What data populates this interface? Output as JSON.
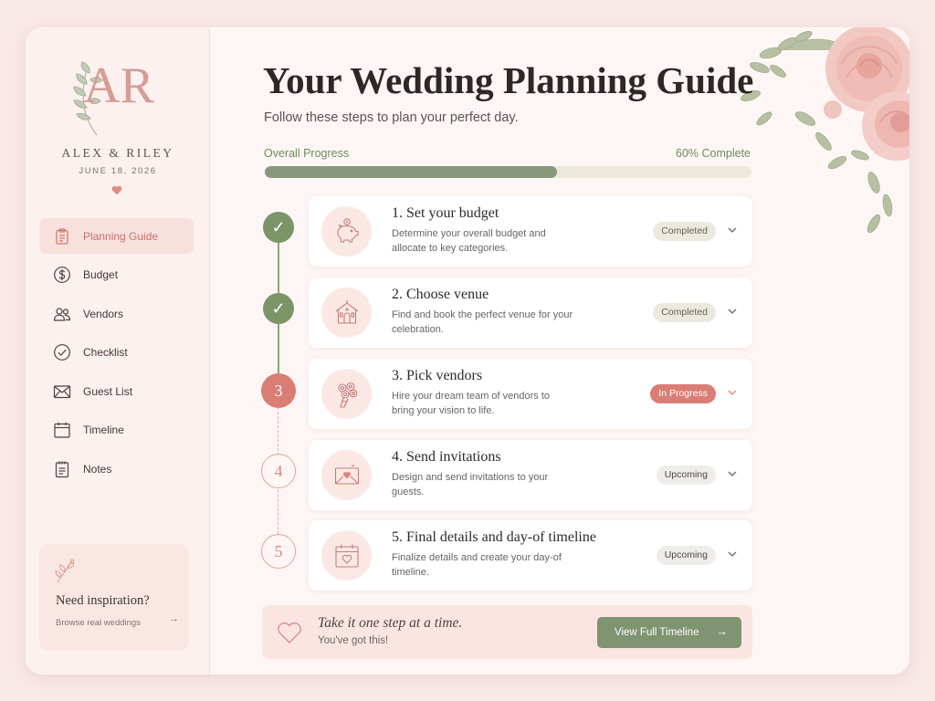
{
  "brand": {
    "monogram": "AR",
    "couple_name": "ALEX & RILEY",
    "wedding_date": "JUNE 18, 2026",
    "accent_color": "#d97d75",
    "sage_color": "#7f9470"
  },
  "sidebar": {
    "items": [
      {
        "label": "Planning Guide",
        "icon": "clipboard-icon",
        "active": true
      },
      {
        "label": "Budget",
        "icon": "dollar-icon",
        "active": false
      },
      {
        "label": "Vendors",
        "icon": "people-icon",
        "active": false
      },
      {
        "label": "Checklist",
        "icon": "check-circle-icon",
        "active": false
      },
      {
        "label": "Guest List",
        "icon": "envelope-icon",
        "active": false
      },
      {
        "label": "Timeline",
        "icon": "calendar-icon",
        "active": false
      },
      {
        "label": "Notes",
        "icon": "notepad-icon",
        "active": false
      }
    ],
    "inspiration": {
      "title": "Need inspiration?",
      "link_label": "Browse real weddings",
      "arrow": "→"
    }
  },
  "header": {
    "title": "Your Wedding Planning Guide",
    "subtitle": "Follow these steps to plan your perfect day."
  },
  "progress": {
    "label": "Overall Progress",
    "percent_label": "60% Complete",
    "value": 0.6
  },
  "steps": [
    {
      "marker": "✓",
      "title": "1. Set your budget",
      "desc": "Determine your overall budget and allocate to key categories.",
      "status": "Completed",
      "icon": "piggy-bank-icon"
    },
    {
      "marker": "✓",
      "title": "2. Choose venue",
      "desc": "Find and book the perfect venue for your celebration.",
      "status": "Completed",
      "icon": "venue-icon"
    },
    {
      "marker": "3",
      "title": "3. Pick vendors",
      "desc": "Hire your dream team of vendors to bring your vision to life.",
      "status": "In Progress",
      "icon": "bouquet-icon"
    },
    {
      "marker": "4",
      "title": "4. Send invitations",
      "desc": "Design and send invitations to your guests.",
      "status": "Upcoming",
      "icon": "invitation-icon"
    },
    {
      "marker": "5",
      "title": "5. Final details and day-of timeline",
      "desc": "Finalize details and create your day-of timeline.",
      "status": "Upcoming",
      "icon": "calendar-heart-icon"
    }
  ],
  "footer": {
    "quote": "Take it one step at a time.",
    "sub": "You've got this!",
    "cta_label": "View Full Timeline",
    "cta_arrow": "→"
  }
}
